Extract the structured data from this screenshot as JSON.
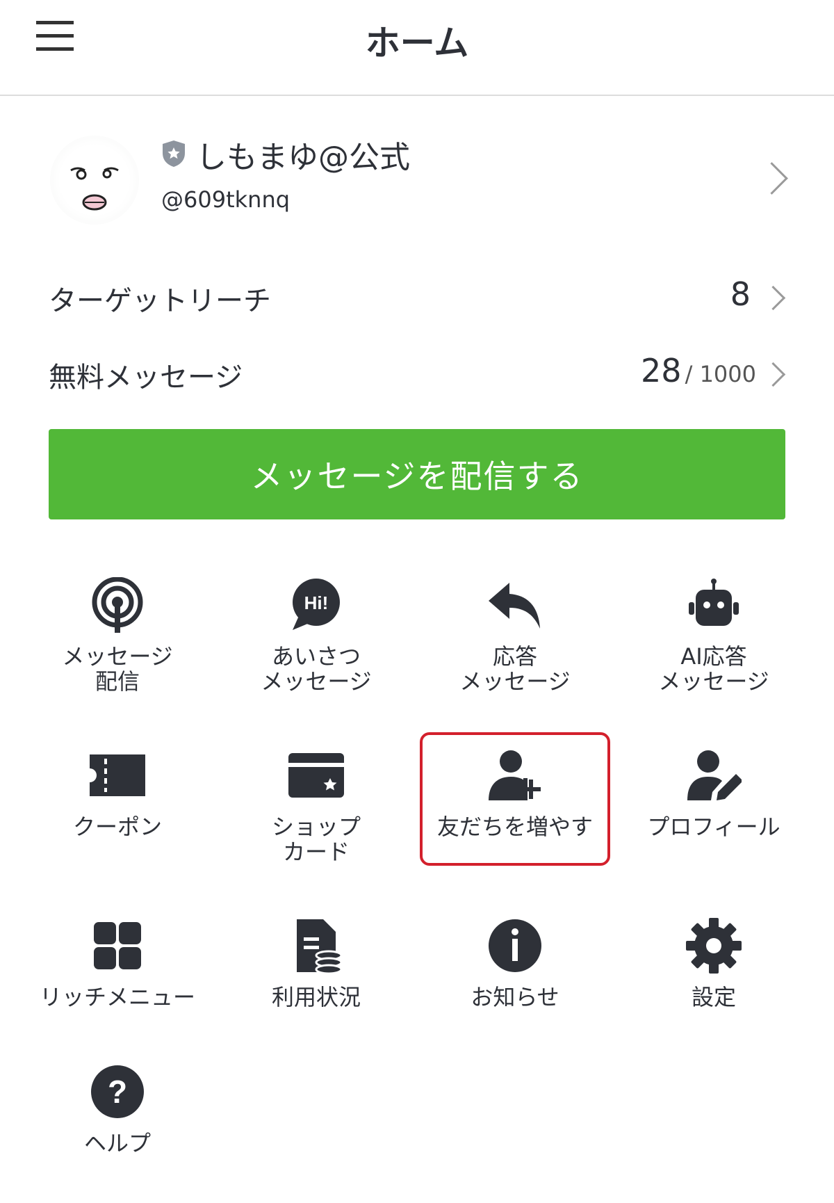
{
  "header": {
    "title": "ホーム"
  },
  "profile": {
    "name": "しもまゆ@公式",
    "handle": "@609tknnq"
  },
  "stats": {
    "target_reach_label": "ターゲットリーチ",
    "target_reach_value": "8",
    "free_messages_label": "無料メッセージ",
    "free_messages_used": "28",
    "free_messages_limit": "/ 1000"
  },
  "send_button_label": "メッセージを配信する",
  "menu": [
    {
      "label": "メッセージ\n配信",
      "icon": "broadcast-icon"
    },
    {
      "label": "あいさつ\nメッセージ",
      "icon": "hi-speech-bubble-icon"
    },
    {
      "label": "応答\nメッセージ",
      "icon": "reply-arrow-icon"
    },
    {
      "label": "AI応答\nメッセージ",
      "icon": "robot-icon"
    },
    {
      "label": "クーポン",
      "icon": "ticket-icon"
    },
    {
      "label": "ショップ\nカード",
      "icon": "shop-card-icon"
    },
    {
      "label": "友だちを増やす",
      "icon": "add-friend-icon"
    },
    {
      "label": "プロフィール",
      "icon": "profile-edit-icon"
    },
    {
      "label": "リッチメニュー",
      "icon": "grid-icon"
    },
    {
      "label": "利用状況",
      "icon": "usage-document-icon"
    },
    {
      "label": "お知らせ",
      "icon": "info-icon"
    },
    {
      "label": "設定",
      "icon": "gear-icon"
    },
    {
      "label": "ヘルプ",
      "icon": "help-icon"
    }
  ],
  "colors": {
    "accent_green": "#52b838",
    "highlight_red": "#d3202c",
    "icon_dark": "#2e3138"
  }
}
